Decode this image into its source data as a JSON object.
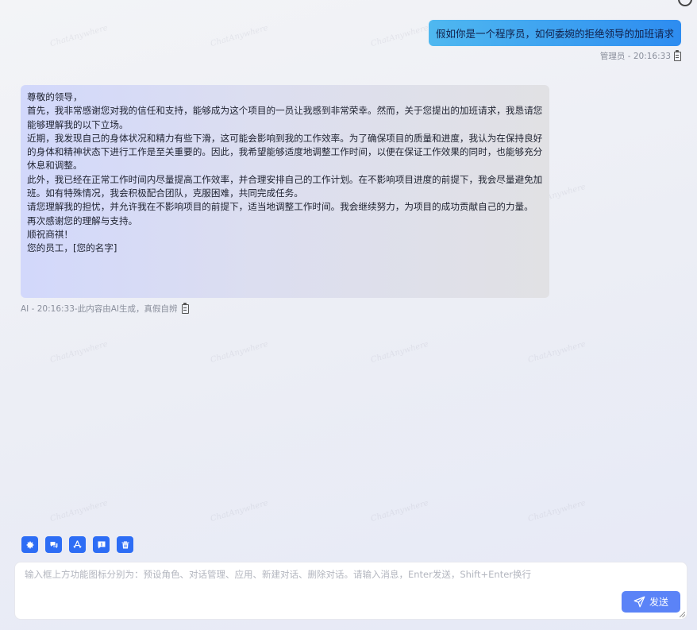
{
  "watermark": "ChatAnywhere",
  "conversation": {
    "user_message": {
      "text": "假如你是一个程序员，如何委婉的拒绝领导的加班请求",
      "meta": "管理员 - 20:16:33"
    },
    "ai_message": {
      "lines": [
        "尊敬的领导，",
        "首先，我非常感谢您对我的信任和支持，能够成为这个项目的一员让我感到非常荣幸。然而，关于您提出的加班请求，我恳请您能够理解我的以下立场。",
        "近期，我发现自己的身体状况和精力有些下滑，这可能会影响到我的工作效率。为了确保项目的质量和进度，我认为在保持良好的身体和精神状态下进行工作是至关重要的。因此，我希望能够适度地调整工作时间，以便在保证工作效果的同时，也能够充分休息和调整。",
        "此外，我已经在正常工作时间内尽量提高工作效率，并合理安排自己的工作计划。在不影响项目进度的前提下，我会尽量避免加班。如有特殊情况，我会积极配合团队，克服困难，共同完成任务。",
        "请您理解我的担忧，并允许我在不影响项目的前提下，适当地调整工作时间。我会继续努力，为项目的成功贡献自己的力量。",
        "再次感谢您的理解与支持。",
        "顺祝商祺！",
        "您的员工，[您的名字]"
      ],
      "meta": "AI - 20:16:33-此内容由AI生成，真假自辨"
    }
  },
  "toolbar": {
    "buttons": [
      {
        "name": "preset-role",
        "icon": "gear-icon"
      },
      {
        "name": "conversation-manage",
        "icon": "chat-bubbles-icon"
      },
      {
        "name": "apps",
        "icon": "apps-icon"
      },
      {
        "name": "new-conversation",
        "icon": "new-chat-icon"
      },
      {
        "name": "delete-conversation",
        "icon": "trash-icon"
      }
    ]
  },
  "input": {
    "placeholder": "输入框上方功能图标分别为：预设角色、对话管理、应用、新建对话、删除对话。请输入消息，Enter发送，Shift+Enter换行",
    "value": ""
  },
  "send_button": {
    "label": "发送",
    "icon": "paper-plane-icon"
  },
  "colors": {
    "accent": "#2d6df5",
    "user_bubble_start": "#4fb8f0",
    "user_bubble_end": "#2d8cf0",
    "send_button": "#5b83f7"
  }
}
